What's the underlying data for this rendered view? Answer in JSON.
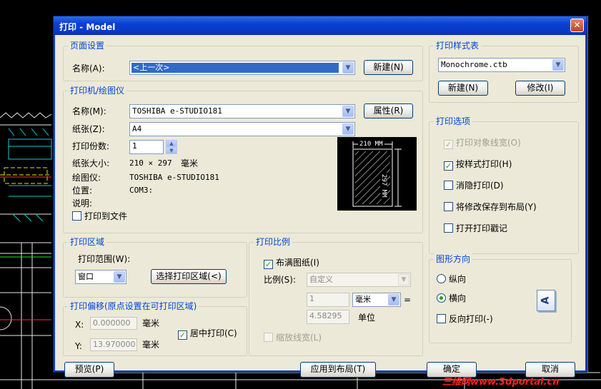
{
  "window": {
    "title": "打印 - Model",
    "close_glyph": "✕"
  },
  "page_setup": {
    "label": "页面设置",
    "name_label": "名称(A):",
    "name_value": "<上一次>",
    "new_button": "新建(N)"
  },
  "printer": {
    "label": "打印机/绘图仪",
    "name_label": "名称(M):",
    "name_value": "TOSHIBA e-STUDIO181",
    "properties_button": "属性(R)",
    "paper_label": "纸张(Z):",
    "paper_value": "A4",
    "copies_label": "打印份数:",
    "copies_value": "1",
    "size_label": "纸张大小:",
    "size_value": "210 × 297",
    "size_unit": "毫米",
    "plotter_label": "绘图仪:",
    "plotter_value": "TOSHIBA e-STUDIO181",
    "location_label": "位置:",
    "location_value": "COM3:",
    "description_label": "说明:",
    "print_to_file": "打印到文件",
    "preview_width_label": "210 MM",
    "preview_height_label": "297 MM"
  },
  "plot_area": {
    "label": "打印区域",
    "range_label": "打印范围(W):",
    "range_value": "窗口",
    "select_button": "选择打印区域(<)"
  },
  "plot_offset": {
    "label": "打印偏移(原点设置在可打印区域)",
    "x_label": "X:",
    "x_value": "0.000000",
    "y_label": "Y:",
    "y_value": "13.970000",
    "unit": "毫米",
    "center_plot": "居中打印(C)"
  },
  "plot_scale": {
    "label": "打印比例",
    "fit_paper": "布满图纸(I)",
    "scale_label": "比例(S):",
    "scale_value": "自定义",
    "value1": "1",
    "unit_value": "毫米",
    "equals": "=",
    "value2": "4.58295",
    "unit_label": "单位",
    "scale_lineweights": "缩放线宽(L)"
  },
  "plot_style_table": {
    "label": "打印样式表",
    "value": "Monochrome.ctb",
    "new_button": "新建(N)",
    "edit_button": "修改(I)"
  },
  "plot_options": {
    "label": "打印选项",
    "items": [
      {
        "label": "打印对象线宽(O)",
        "checked": true,
        "disabled": true
      },
      {
        "label": "按样式打印(H)",
        "checked": true,
        "disabled": false
      },
      {
        "label": "消隐打印(D)",
        "checked": false,
        "disabled": false
      },
      {
        "label": "将修改保存到布局(Y)",
        "checked": false,
        "disabled": false
      },
      {
        "label": "打开打印戳记",
        "checked": false,
        "disabled": false
      }
    ]
  },
  "orientation": {
    "label": "图形方向",
    "portrait": "纵向",
    "landscape": "横向",
    "upside_down": "反向打印(-)",
    "selected": "landscape",
    "icon_letter": "A"
  },
  "footer": {
    "preview_button": "预览(P)",
    "apply_button": "应用到布局(T)",
    "ok_button": "确定",
    "cancel_button": "取消"
  },
  "watermark": "三维网www.3dportal.cn",
  "colors": {
    "title_blue": "#0a3fd0",
    "group_label": "#0046d5",
    "check_green": "#21a121",
    "cad_background": "#000000"
  }
}
